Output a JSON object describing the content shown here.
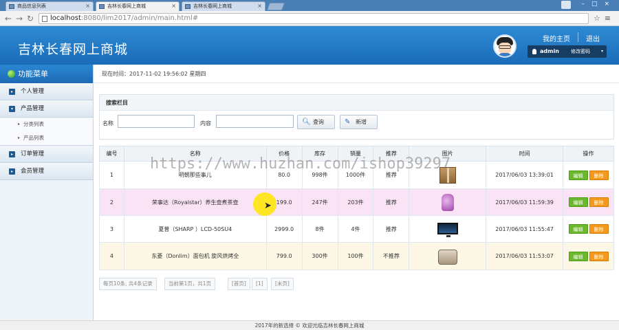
{
  "browser": {
    "tabs": [
      {
        "label": "商品信息列表",
        "active": false
      },
      {
        "label": "吉林长春网上商城",
        "active": true
      },
      {
        "label": "吉林长春网上商城",
        "active": false
      }
    ],
    "url_host": "localhost",
    "url_rest": ":8080/lim2017/admin/main.html#"
  },
  "header": {
    "title": "吉林长春网上商城",
    "my_home": "我的主页",
    "logout": "退出",
    "username": "admin",
    "change_password": "修改密码"
  },
  "sidebar": {
    "title": "功能菜单",
    "items": [
      {
        "label": "个人管理",
        "icon": "▸"
      },
      {
        "label": "产品管理",
        "icon": "▾",
        "children": [
          "分类列表",
          "产品列表"
        ]
      },
      {
        "label": "订单管理",
        "icon": "▸"
      },
      {
        "label": "会员管理",
        "icon": "▸"
      }
    ]
  },
  "main": {
    "current_time": "现在时间：2017-11-02 19:56:02 星期四",
    "search": {
      "title": "搜索栏目",
      "name_label": "名称",
      "content_label": "内容",
      "name_value": "",
      "content_value": "",
      "query_button": "查询",
      "add_button": "新增"
    },
    "table": {
      "headers": [
        "编号",
        "名称",
        "价格",
        "库存",
        "销量",
        "推荐",
        "图片",
        "时间",
        "操作"
      ],
      "rows": [
        {
          "id": "1",
          "name": "明朝那些事儿",
          "price": "80.0",
          "stock": "998件",
          "sales": "1000件",
          "recommend": "推荐",
          "image": "book-box-image",
          "time": "2017/06/03 13:39:01"
        },
        {
          "id": "2",
          "name": "荣事达（Royalstar）养生壶煮茶壶",
          "price": "199.0",
          "stock": "247件",
          "sales": "203件",
          "recommend": "推荐",
          "image": "kettle-image",
          "time": "2017/06/03 11:59:39"
        },
        {
          "id": "3",
          "name": "夏普（SHARP ）LCD-50SU4",
          "price": "2999.0",
          "stock": "8件",
          "sales": "4件",
          "recommend": "推荐",
          "image": "tv-image",
          "time": "2017/06/03 11:55:47"
        },
        {
          "id": "4",
          "name": "东菱（Donlim）面包机 旋风烘烤全",
          "price": "799.0",
          "stock": "300件",
          "sales": "100件",
          "recommend": "不推荐",
          "image": "bread-maker-image",
          "time": "2017/06/03 11:53:07"
        }
      ],
      "edit_label": "编辑",
      "delete_label": "删除"
    },
    "pager": {
      "summary": "每页10条, 共4条记录",
      "current": "当前第1页，共1页",
      "first": "[首页]",
      "page1": "[1]",
      "last": "[末页]"
    }
  },
  "footer": {
    "text": "2017年的新选择 © 欢迎光临吉林长春网上商城"
  },
  "watermark": "https://www.huzhan.com/ishop39297",
  "colors": {
    "header_blue": "#1a6cb8",
    "edit_green": "#6cb82c",
    "delete_orange": "#f39a1c",
    "highlight_pink": "#fbe3f6"
  }
}
